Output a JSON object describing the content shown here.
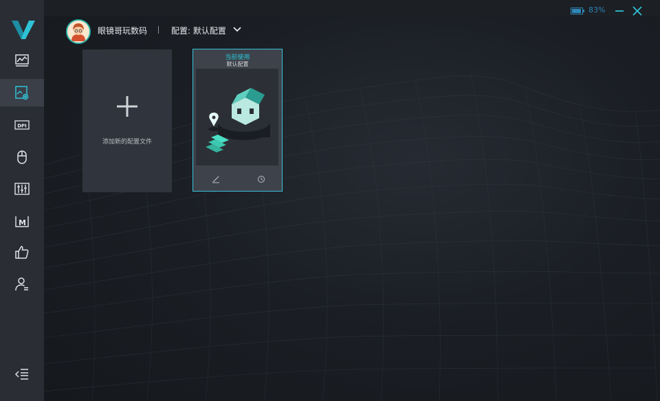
{
  "window": {
    "battery_percent": "83%",
    "minimize_icon": "minimize-icon",
    "close_icon": "close-icon"
  },
  "colors": {
    "accent": "#2ab3a6",
    "highlight": "#39c2d9",
    "sidebar_bg": "#2a2d34",
    "battery": "#2f86b8"
  },
  "sidebar": {
    "logo": "v-logo",
    "items": [
      {
        "icon": "performance-chart-icon",
        "active": false
      },
      {
        "icon": "profile-config-icon",
        "active": true
      },
      {
        "icon": "dpi-icon",
        "active": false
      },
      {
        "icon": "mouse-icon",
        "active": false
      },
      {
        "icon": "equalizer-sliders-icon",
        "active": false
      },
      {
        "icon": "macro-icon",
        "active": false
      },
      {
        "icon": "thumbs-up-icon",
        "active": false
      },
      {
        "icon": "user-account-icon",
        "active": false
      }
    ],
    "collapse_icon": "collapse-menu-icon"
  },
  "header": {
    "user_name": "眼镜哥玩数码",
    "profile_label": "配置: 默认配置"
  },
  "cards": {
    "add_label": "添加新的配置文件",
    "current": {
      "status": "当前使用",
      "name": "默认配置",
      "edit_icon": "edit-pen-icon",
      "history_icon": "history-clock-icon"
    }
  }
}
